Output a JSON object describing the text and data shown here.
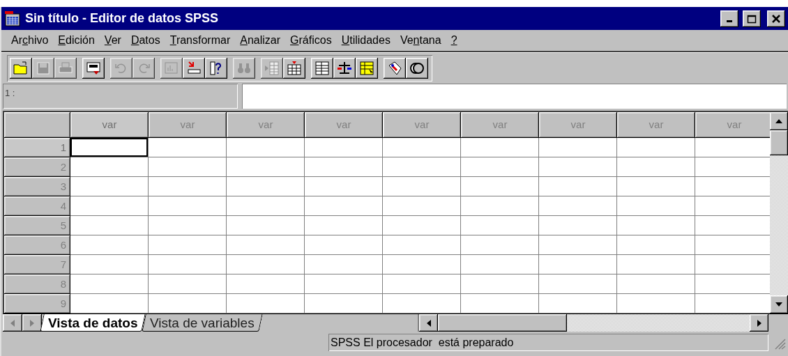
{
  "window": {
    "title": "Sin título - Editor de datos SPSS"
  },
  "menu": [
    {
      "before": "Ar",
      "key": "c",
      "after": "hivo"
    },
    {
      "key": "E",
      "after": "dición"
    },
    {
      "key": "V",
      "after": "er"
    },
    {
      "key": "D",
      "after": "atos"
    },
    {
      "key": "T",
      "after": "ransformar"
    },
    {
      "key": "A",
      "after": "nalizar"
    },
    {
      "key": "G",
      "after": "ráficos"
    },
    {
      "key": "U",
      "after": "tilidades"
    },
    {
      "before": "Ve",
      "key": "n",
      "after": "tana"
    },
    {
      "key": "?"
    }
  ],
  "toolbar": {
    "groups": [
      [
        {
          "kind": "open",
          "disabled": false
        },
        {
          "kind": "save",
          "disabled": true
        },
        {
          "kind": "print",
          "disabled": true
        }
      ],
      [
        {
          "kind": "dialog",
          "disabled": false
        }
      ],
      [
        {
          "kind": "undo",
          "disabled": true
        },
        {
          "kind": "redo",
          "disabled": true
        }
      ],
      [
        {
          "kind": "chart",
          "disabled": true
        },
        {
          "kind": "goto",
          "disabled": false
        },
        {
          "kind": "info",
          "disabled": false
        }
      ],
      [
        {
          "kind": "find",
          "disabled": true
        }
      ],
      [
        {
          "kind": "insert-row",
          "disabled": true
        },
        {
          "kind": "insert-column",
          "disabled": false
        }
      ],
      [
        {
          "kind": "split",
          "disabled": false
        },
        {
          "kind": "scale",
          "disabled": false
        },
        {
          "kind": "select",
          "disabled": false
        }
      ],
      [
        {
          "kind": "tag",
          "disabled": false
        },
        {
          "kind": "circles",
          "disabled": false
        }
      ]
    ]
  },
  "cell_editor": {
    "cell_ref": "1 :"
  },
  "grid": {
    "columns": [
      {
        "label": "var",
        "selected": true
      },
      {
        "label": "var",
        "selected": false
      },
      {
        "label": "var",
        "selected": false
      },
      {
        "label": "var",
        "selected": false
      },
      {
        "label": "var",
        "selected": false
      },
      {
        "label": "var",
        "selected": false
      },
      {
        "label": "var",
        "selected": false
      },
      {
        "label": "var",
        "selected": false
      },
      {
        "label": "var",
        "selected": false
      }
    ],
    "rows": [
      {
        "number": "1",
        "selected": true
      },
      {
        "number": "2",
        "selected": false
      },
      {
        "number": "3",
        "selected": false
      },
      {
        "number": "4",
        "selected": false
      },
      {
        "number": "5",
        "selected": false
      },
      {
        "number": "6",
        "selected": false
      },
      {
        "number": "7",
        "selected": false
      },
      {
        "number": "8",
        "selected": false
      },
      {
        "number": "9",
        "selected": false
      }
    ]
  },
  "tabs": [
    {
      "label": "Vista de datos",
      "selected": true
    },
    {
      "label": "Vista de variables",
      "selected": false
    }
  ],
  "status_bar": {
    "text": "SPSS El procesador  está preparado"
  }
}
